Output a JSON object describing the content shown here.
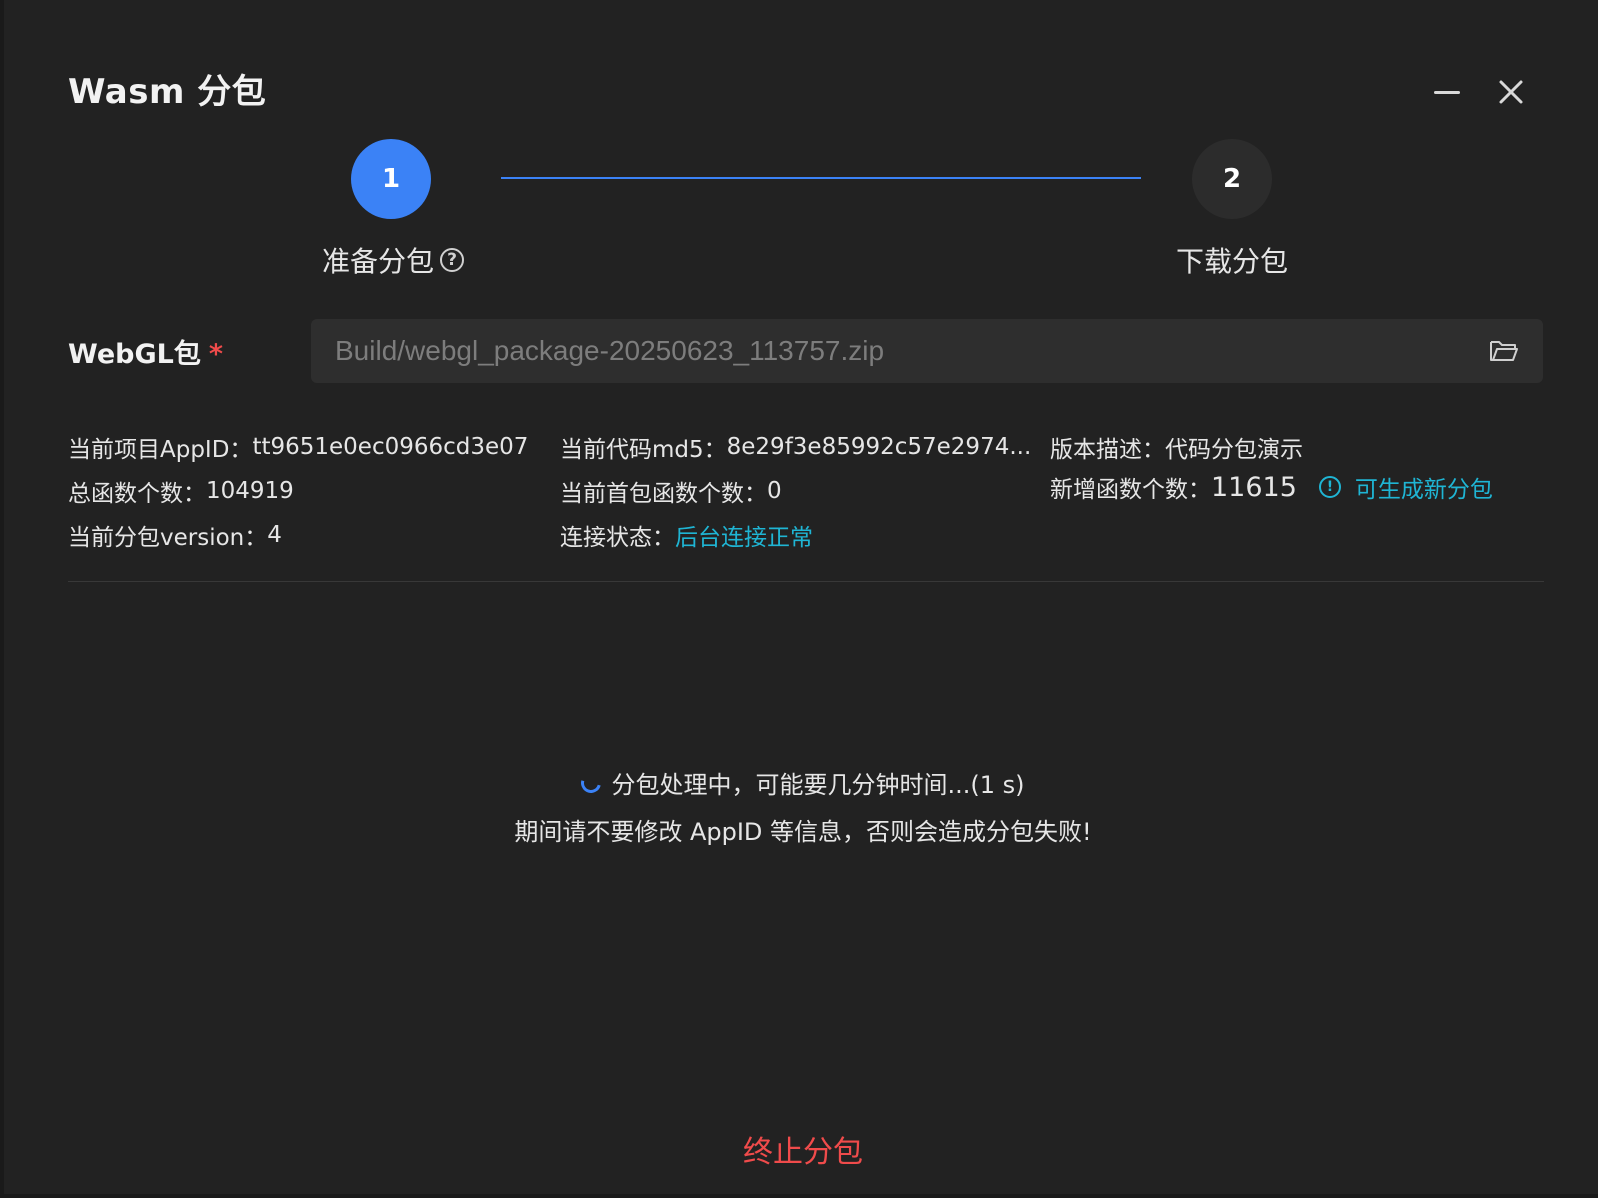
{
  "dialog": {
    "title": "Wasm 分包"
  },
  "steps": [
    {
      "number": "1",
      "label": "准备分包",
      "active": true
    },
    {
      "number": "2",
      "label": "下载分包",
      "active": false
    }
  ],
  "webgl": {
    "label": "WebGL包",
    "required_mark": "*",
    "value": "Build/webgl_package-20250623_113757.zip"
  },
  "info": {
    "appid_label": "当前项目AppID：",
    "appid_value": "tt9651e0ec0966cd3e07",
    "md5_label": "当前代码md5：",
    "md5_value": "8e29f3e85992c57e2974...",
    "desc_label": "版本描述：",
    "desc_value": "代码分包演示",
    "total_label": "总函数个数：",
    "total_value": "104919",
    "first_label": "当前首包函数个数：",
    "first_value": "0",
    "new_label": "新增函数个数：",
    "new_value": "11615",
    "new_hint": "可生成新分包",
    "version_label": "当前分包version：",
    "version_value": "4",
    "conn_label": "连接状态：",
    "conn_value": "后台连接正常"
  },
  "progress": {
    "line1": "分包处理中，可能要几分钟时间...(1 s)",
    "line2": "期间请不要修改 AppID 等信息，否则会造成分包失败!"
  },
  "actions": {
    "stop_label": "终止分包"
  },
  "colors": {
    "accent": "#3b82f6",
    "link": "#1fb5d4",
    "danger": "#f04b4b",
    "background": "#222222"
  }
}
